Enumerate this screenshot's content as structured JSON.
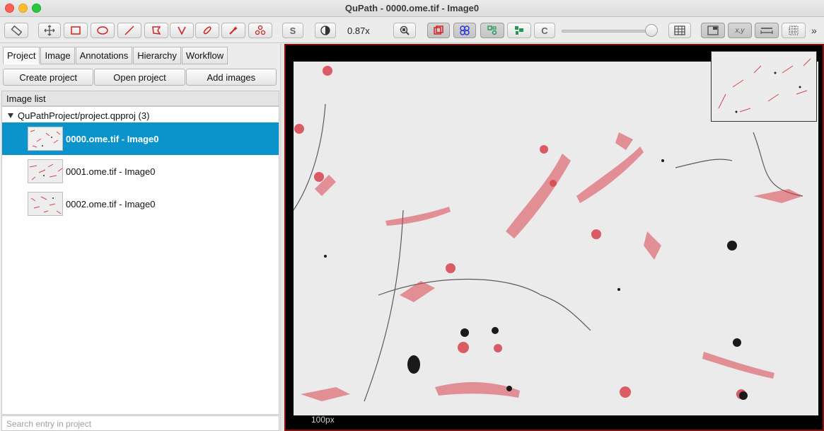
{
  "window": {
    "title": "QuPath - 0000.ome.tif - Image0"
  },
  "toolbar": {
    "zoom": "0.87x",
    "selection_mode_label": "S",
    "cells_label": "C",
    "coords_label": "x,y",
    "icons": [
      "ruler-icon",
      "move-icon",
      "rectangle-icon",
      "ellipse-icon",
      "line-icon",
      "polygon-icon",
      "polyline-icon",
      "brush-icon",
      "wand-icon",
      "points-icon",
      "contrast-icon",
      "zoom-to-fit-icon",
      "annotation-icon",
      "tma-icon",
      "detection-icon",
      "cell-icon",
      "grid-icon",
      "overview-icon",
      "location-icon",
      "scalebar-icon",
      "pixel-grid-icon"
    ],
    "colors": {
      "tool_red": "#d62020",
      "tma_blue": "#2a3bd8",
      "detection_green": "#1e9a52"
    }
  },
  "left": {
    "tabs": [
      "Project",
      "Image",
      "Annotations",
      "Hierarchy",
      "Workflow"
    ],
    "buttons": {
      "create": "Create project",
      "open": "Open project",
      "add": "Add images"
    },
    "list_header": "Image list",
    "root_label": "QuPathProject/project.qpproj (3)",
    "items": [
      {
        "label": "0000.ome.tif - Image0"
      },
      {
        "label": "0001.ome.tif - Image0"
      },
      {
        "label": "0002.ome.tif - Image0"
      }
    ],
    "search_placeholder": "Search entry in project",
    "selected_color": "#0b94cb"
  },
  "viewer": {
    "scalebar": "100px",
    "cell_color": "#d9434e"
  }
}
